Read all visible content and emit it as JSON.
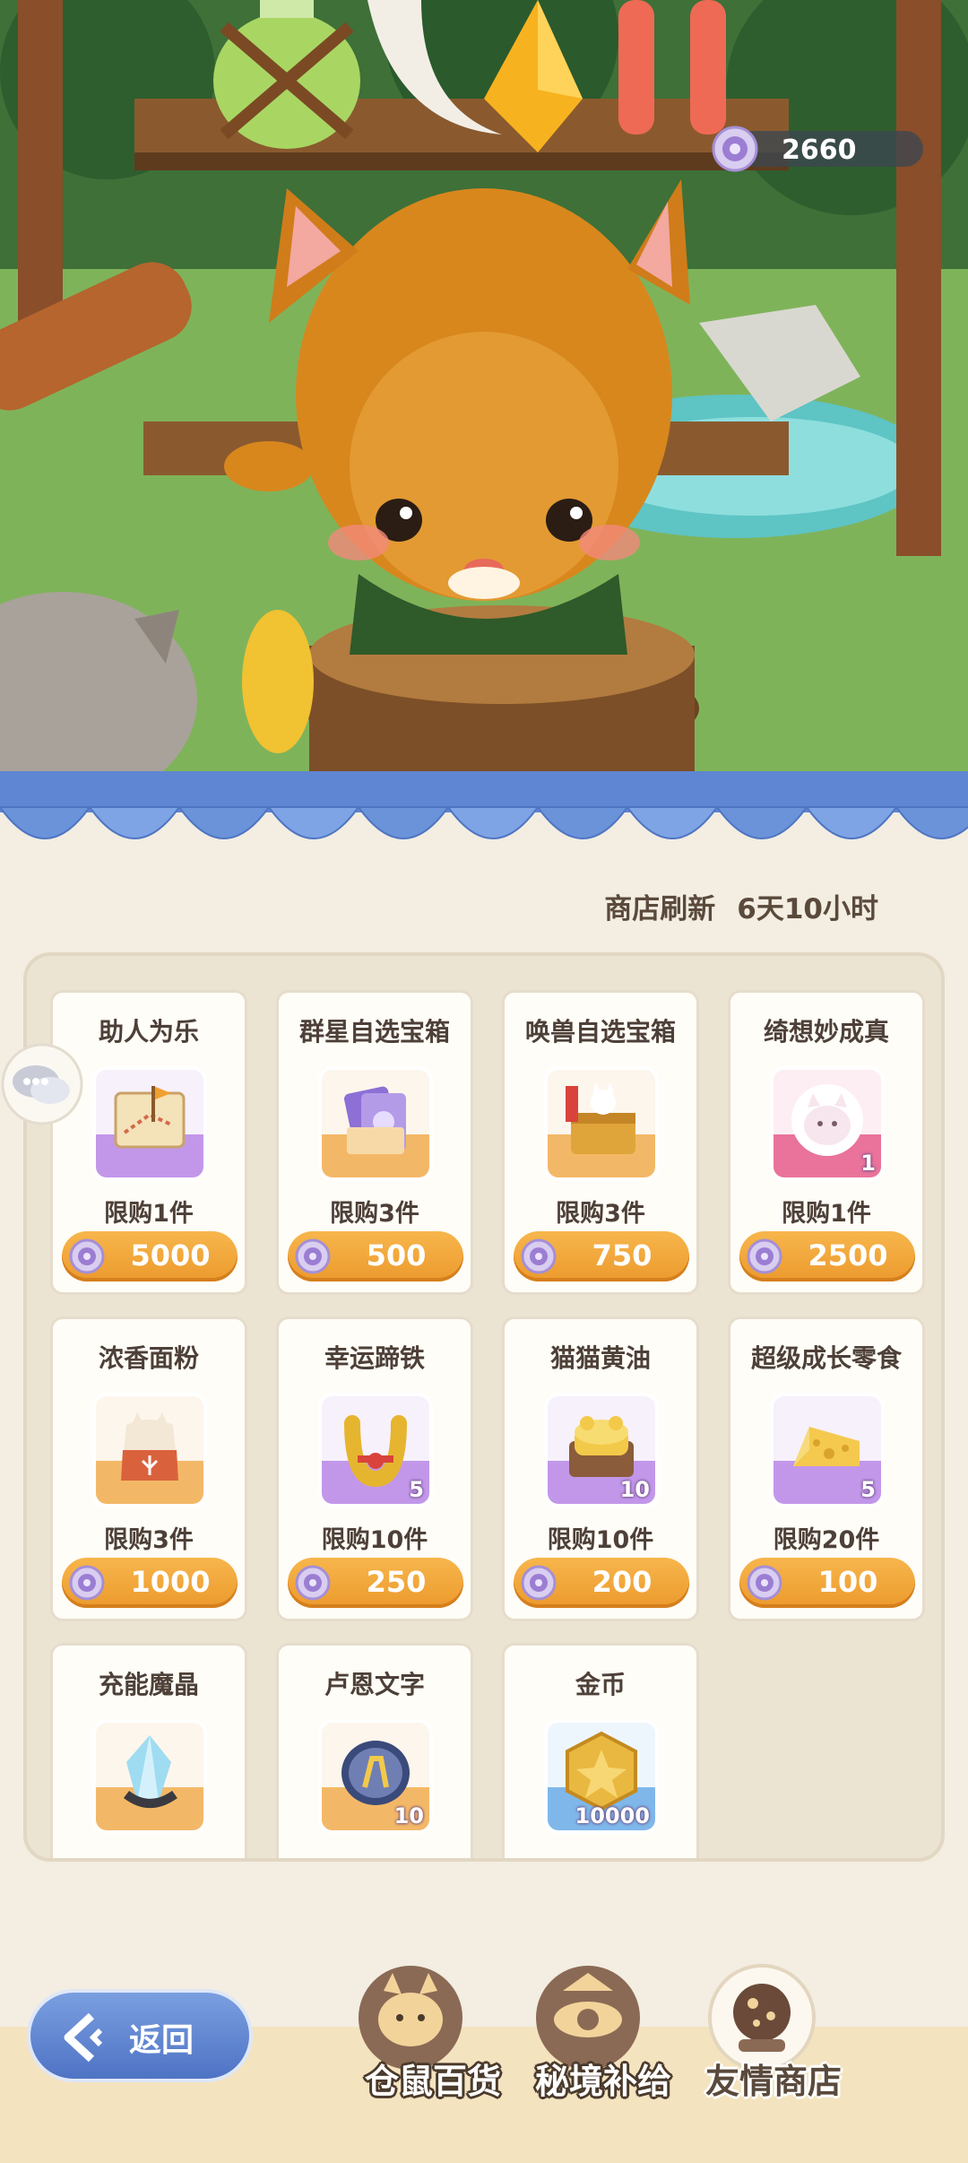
{
  "currency": {
    "amount": "2660",
    "icon": "spirit-coin-icon"
  },
  "refresh": {
    "label": "商店刷新",
    "time": "6天10小时"
  },
  "items": [
    {
      "name": "助人为乐",
      "limit": "限购1件",
      "price": "5000",
      "badge": "",
      "icon": "treasure-map-icon",
      "frame": "purple"
    },
    {
      "name": "群星自选宝箱",
      "limit": "限购3件",
      "price": "500",
      "badge": "",
      "icon": "star-cards-icon",
      "frame": "orange"
    },
    {
      "name": "唤兽自选宝箱",
      "limit": "限购3件",
      "price": "750",
      "badge": "",
      "icon": "beast-chest-icon",
      "frame": "orange"
    },
    {
      "name": "绮想妙成真",
      "limit": "限购1件",
      "price": "2500",
      "badge": "1",
      "icon": "cat-avatar-icon",
      "frame": "pink"
    },
    {
      "name": "浓香面粉",
      "limit": "限购3件",
      "price": "1000",
      "badge": "",
      "icon": "flour-bag-icon",
      "frame": "orange"
    },
    {
      "name": "幸运蹄铁",
      "limit": "限购10件",
      "price": "250",
      "badge": "5",
      "icon": "horseshoe-icon",
      "frame": "purple"
    },
    {
      "name": "猫猫黄油",
      "limit": "限购10件",
      "price": "200",
      "badge": "10",
      "icon": "butter-icon",
      "frame": "purple"
    },
    {
      "name": "超级成长零食",
      "limit": "限购20件",
      "price": "100",
      "badge": "5",
      "icon": "cheese-icon",
      "frame": "purple"
    },
    {
      "name": "充能魔晶",
      "limit": "",
      "price": "",
      "badge": "",
      "icon": "magic-crystal-icon",
      "frame": "orange"
    },
    {
      "name": "卢恩文字",
      "limit": "",
      "price": "",
      "badge": "10",
      "icon": "rune-stone-icon",
      "frame": "orange"
    },
    {
      "name": "金币",
      "limit": "",
      "price": "",
      "badge": "10000",
      "icon": "gold-coin-icon",
      "frame": "blue"
    }
  ],
  "back_button": {
    "label": "返回"
  },
  "tabs": [
    {
      "label": "仓鼠百货",
      "icon": "hamster-icon",
      "active": false
    },
    {
      "label": "秘境补给",
      "icon": "eye-emblem-icon",
      "active": false
    },
    {
      "label": "友情商店",
      "icon": "cookie-globe-icon",
      "active": true
    }
  ],
  "colors": {
    "accent": "#ec9a2d",
    "awning": "#6a93da",
    "panel": "#ece4d3",
    "text": "#4d4038"
  }
}
